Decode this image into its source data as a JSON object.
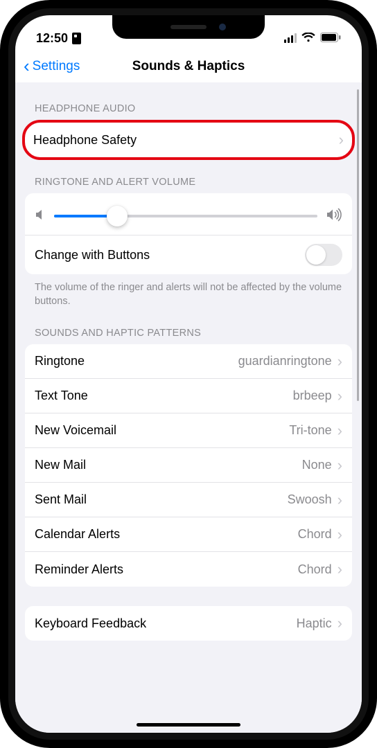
{
  "status": {
    "time": "12:50"
  },
  "nav": {
    "back": "Settings",
    "title": "Sounds & Haptics"
  },
  "sections": {
    "headphone": {
      "header": "HEADPHONE AUDIO",
      "safety": "Headphone Safety"
    },
    "ringtone_volume": {
      "header": "RINGTONE AND ALERT VOLUME",
      "slider_percent": 24,
      "change_with_buttons": {
        "label": "Change with Buttons",
        "on": false
      },
      "footer": "The volume of the ringer and alerts will not be affected by the volume buttons."
    },
    "patterns": {
      "header": "SOUNDS AND HAPTIC PATTERNS",
      "items": [
        {
          "label": "Ringtone",
          "value": "guardianringtone"
        },
        {
          "label": "Text Tone",
          "value": "brbeep"
        },
        {
          "label": "New Voicemail",
          "value": "Tri-tone"
        },
        {
          "label": "New Mail",
          "value": "None"
        },
        {
          "label": "Sent Mail",
          "value": "Swoosh"
        },
        {
          "label": "Calendar Alerts",
          "value": "Chord"
        },
        {
          "label": "Reminder Alerts",
          "value": "Chord"
        }
      ]
    },
    "keyboard": {
      "label": "Keyboard Feedback",
      "value": "Haptic"
    }
  }
}
